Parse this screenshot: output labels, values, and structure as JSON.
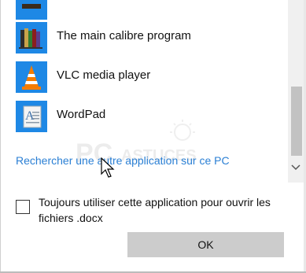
{
  "apps": [
    {
      "label": "",
      "icon": "books-icon-partial"
    },
    {
      "label": "The main calibre program",
      "icon": "calibre-books-icon"
    },
    {
      "label": "VLC media player",
      "icon": "vlc-cone-icon"
    },
    {
      "label": "WordPad",
      "icon": "wordpad-icon"
    }
  ],
  "search_link": "Rechercher une autre application sur ce PC",
  "checkbox": {
    "label": "Toujours utiliser cette application pour ouvrir les fichiers .docx",
    "checked": false
  },
  "ok_button": "OK",
  "watermark": {
    "text": "PC ASTUCES"
  },
  "colors": {
    "link": "#2a7fd4",
    "button_bg": "#cccccc",
    "scroll_thumb": "#c2c2c2"
  }
}
